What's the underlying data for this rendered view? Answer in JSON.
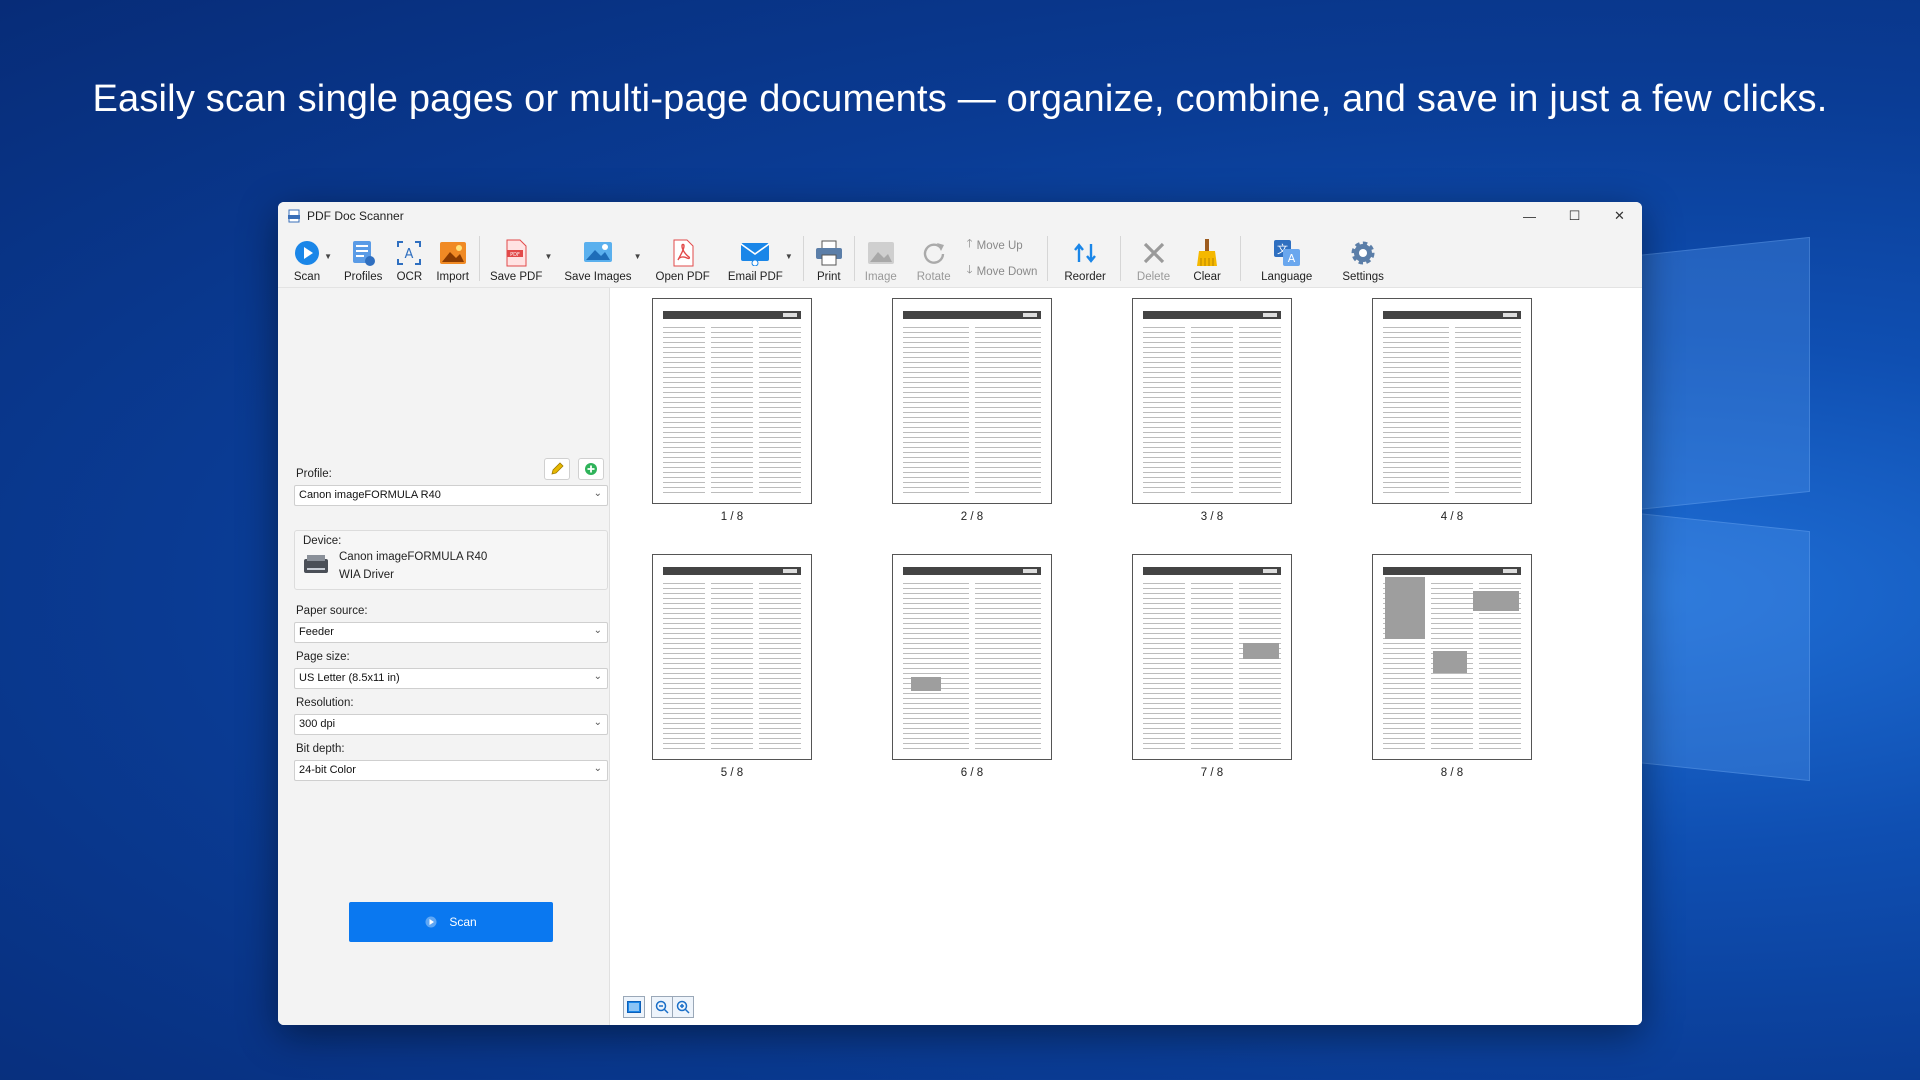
{
  "headline": "Easily scan single pages or multi-page documents — organize, combine, and save in just a few clicks.",
  "window": {
    "title": "PDF Doc Scanner",
    "controls": {
      "minimize": "—",
      "maximize": "☐",
      "close": "✕"
    }
  },
  "toolbar": {
    "scan": "Scan",
    "profiles": "Profiles",
    "ocr": "OCR",
    "import": "Import",
    "save_pdf": "Save PDF",
    "save_images": "Save Images",
    "open_pdf": "Open PDF",
    "email_pdf": "Email PDF",
    "print": "Print",
    "image": "Image",
    "rotate": "Rotate",
    "move_up": "Move Up",
    "move_down": "Move Down",
    "reorder": "Reorder",
    "delete": "Delete",
    "clear": "Clear",
    "language": "Language",
    "settings": "Settings"
  },
  "panel": {
    "profile_label": "Profile:",
    "profile_value": "Canon imageFORMULA R40",
    "device_label": "Device:",
    "device_name": "Canon imageFORMULA R40",
    "device_driver": "WIA Driver",
    "paper_source_label": "Paper source:",
    "paper_source_value": "Feeder",
    "page_size_label": "Page size:",
    "page_size_value": "US Letter (8.5x11 in)",
    "resolution_label": "Resolution:",
    "resolution_value": "300 dpi",
    "bit_depth_label": "Bit depth:",
    "bit_depth_value": "24-bit Color",
    "scan_button": "Scan"
  },
  "pages": [
    {
      "label": "1 / 8",
      "header": "Watch Operation Guide 5657"
    },
    {
      "label": "2 / 8",
      "header": "Watch Operation Guide 5657"
    },
    {
      "label": "3 / 8",
      "header": "Watch Operation Guide 5657"
    },
    {
      "label": "4 / 8",
      "header": "Watch Operation Guide 5657"
    },
    {
      "label": "5 / 8",
      "header": "Watch Operation Guide 5657"
    },
    {
      "label": "6 / 8",
      "header": "Watch Operation Guide 5657"
    },
    {
      "label": "7 / 8",
      "header": "Watch Operation Guide 5657"
    },
    {
      "label": "8 / 8",
      "header": "Watch Operation Guide 5657"
    }
  ],
  "colors": {
    "accent": "#0a78f0",
    "background": "#0a3c95"
  }
}
